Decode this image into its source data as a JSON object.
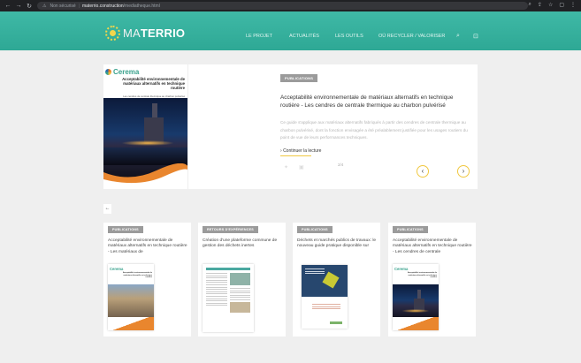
{
  "browser": {
    "security_label": "Non sécurisé",
    "url_domain": "materrio.construction",
    "url_path": "/mediatheque.html"
  },
  "header": {
    "logo_prefix": "MA",
    "logo_main": "TERRIO",
    "logo_tagline": "",
    "menu": [
      {
        "label": "LE PROJET"
      },
      {
        "label": "ACTUALITÉS"
      },
      {
        "label": "LES OUTILS"
      },
      {
        "label": "OÙ RECYCLER / VALORISER"
      }
    ]
  },
  "hero": {
    "cover": {
      "publisher": "Cerema",
      "title": "Acceptabilité environnementale de matériaux alternatifs en technique routière",
      "subtitle": "Les cendres de centrale thermique au charbon pulvérisé"
    },
    "badge": "PUBLICATIONS",
    "title": "Acceptabilité environnementale de matériaux alternatifs en technique routière - Les cendres de centrale thermique au charbon pulvérisé",
    "description": "Ce guide s'applique aux matériaux alternatifs fabriqués à partir des cendres de centrale thermique au charbon pulvérisé, dont la fonction envisagée a été préalablement justifiée pour les usages routiers du point de vue de leurs performances techniques.",
    "read_more": "Continuer la lecture",
    "pager": "2/4"
  },
  "cards": [
    {
      "badge": "PUBLICATIONS",
      "title": "Acceptabilité environnementale de matériaux alternatifs en technique routière - Les matériaux de",
      "thumb_publisher": "Cerema",
      "thumb_title": "Acceptabilité environnementale de matériaux alternatifs en technique routière"
    },
    {
      "badge": "RETOURS D'EXPÉRIENCES",
      "title": "Création d'une plateforme commune de gestion des déchets inertes"
    },
    {
      "badge": "PUBLICATIONS",
      "title": "Déchets et marchés publics de travaux: le nouveau guide pratique disponible sur"
    },
    {
      "badge": "PUBLICATIONS",
      "title": "Acceptabilité environnementale de matériaux alternatifs en technique routière - Les cendres de centrale",
      "thumb_publisher": "Cerema",
      "thumb_title": "Acceptabilité environnementale de matériaux alternatifs en technique routière"
    }
  ],
  "colors": {
    "header": "#34ae9b",
    "accent_yellow": "#f0c841",
    "badge_grey": "#9b9b9b",
    "background": "#efefef"
  }
}
